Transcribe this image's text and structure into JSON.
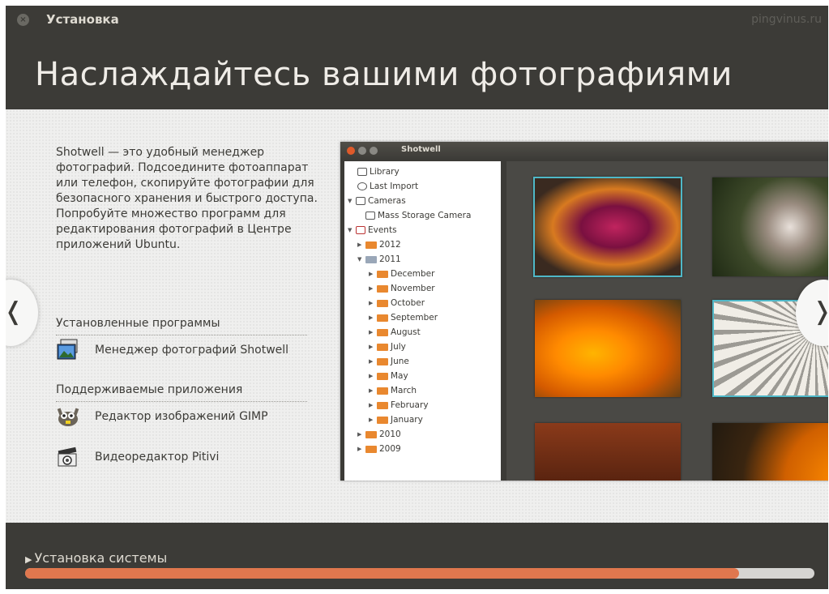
{
  "window": {
    "title": "Установка",
    "watermark": "pingvinus.ru"
  },
  "slide": {
    "heading": "Наслаждайтесь вашими фотографиями",
    "description": "Shotwell — это удобный менеджер фотографий. Подсоедините фотоаппарат или телефон, скопируйте фотографии для безопасного хранения и быстрого доступа. Попробуйте множество программ для редактирования фотографий в Центре приложений Ubuntu.",
    "installed_section": "Установленные программы",
    "installed_apps": [
      {
        "label": "Менеджер фотографий Shotwell",
        "icon": "shotwell-icon"
      }
    ],
    "supported_section": "Поддерживаемые приложения",
    "supported_apps": [
      {
        "label": "Редактор изображений GIMP",
        "icon": "gimp-icon"
      },
      {
        "label": "Видеоредактор Pitivi",
        "icon": "pitivi-icon"
      }
    ],
    "nav_prev": "❬",
    "nav_next": "❭"
  },
  "shotwell": {
    "title": "Shotwell",
    "tree": [
      {
        "label": "Library",
        "icon": "library-icon"
      },
      {
        "label": "Last Import",
        "icon": "last-import-icon"
      },
      {
        "label": "Cameras",
        "icon": "cameras-icon"
      },
      {
        "label": "Mass Storage Camera",
        "icon": "camera-icon"
      },
      {
        "label": "Events",
        "icon": "events-icon"
      },
      {
        "label": "2012",
        "icon": "folder-icon"
      },
      {
        "label": "2011",
        "icon": "folder-icon"
      },
      {
        "label": "December",
        "icon": "folder-icon"
      },
      {
        "label": "November",
        "icon": "folder-icon"
      },
      {
        "label": "October",
        "icon": "folder-icon"
      },
      {
        "label": "September",
        "icon": "folder-icon"
      },
      {
        "label": "August",
        "icon": "folder-icon"
      },
      {
        "label": "July",
        "icon": "folder-icon"
      },
      {
        "label": "June",
        "icon": "folder-icon"
      },
      {
        "label": "May",
        "icon": "folder-icon"
      },
      {
        "label": "March",
        "icon": "folder-icon"
      },
      {
        "label": "February",
        "icon": "folder-icon"
      },
      {
        "label": "January",
        "icon": "folder-icon"
      },
      {
        "label": "2010",
        "icon": "folder-icon"
      },
      {
        "label": "2009",
        "icon": "folder-icon"
      }
    ]
  },
  "progress": {
    "label": "Установка системы",
    "expander_icon": "▶",
    "fraction": 0.905,
    "fill_color": "#e0774e"
  },
  "colors": {
    "background_dark": "#3c3b37",
    "accent": "#e0774e",
    "content_bg": "#efefee"
  }
}
